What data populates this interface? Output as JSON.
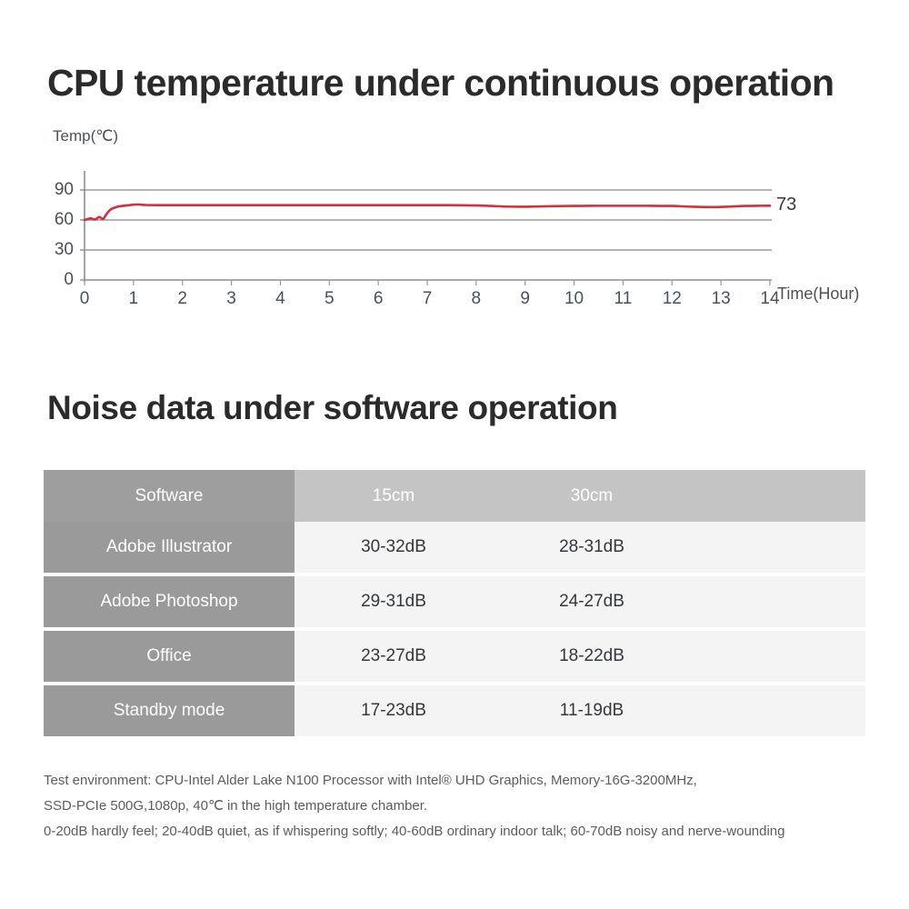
{
  "chart_section": {
    "title": "CPU temperature under continuous operation",
    "end_value_label": "73"
  },
  "chart_data": {
    "type": "line",
    "title": "CPU temperature under continuous operation",
    "xlabel": "Time(Hour)",
    "ylabel": "Temp(℃)",
    "xlim": [
      0,
      14
    ],
    "ylim": [
      0,
      100
    ],
    "grid": true,
    "legend": false,
    "xticks": [
      "0",
      "1",
      "2",
      "3",
      "4",
      "5",
      "6",
      "7",
      "8",
      "9",
      "10",
      "11",
      "12",
      "13",
      "14"
    ],
    "yticks": [
      "0",
      "30",
      "60",
      "90"
    ],
    "line_color": "#d32f3f",
    "series": [
      {
        "name": "CPU temperature",
        "x": [
          0,
          0.12,
          0.22,
          0.3,
          0.38,
          0.45,
          0.55,
          0.7,
          0.85,
          1.0,
          1.1,
          1.25,
          1.5,
          2.0,
          2.5,
          3.0,
          3.5,
          4.0,
          4.5,
          5.0,
          5.5,
          6.0,
          6.5,
          7.0,
          7.5,
          8.0,
          8.3,
          8.6,
          8.9,
          9.2,
          9.6,
          10.0,
          10.5,
          11.0,
          11.5,
          12.0,
          12.3,
          12.6,
          12.9,
          13.2,
          13.5,
          13.8,
          14.0
        ],
        "y": [
          60,
          61.5,
          60.5,
          63,
          61,
          66,
          71,
          73.5,
          74.5,
          75.3,
          75.5,
          75,
          74.8,
          74.8,
          74.8,
          74.8,
          74.8,
          74.8,
          74.8,
          74.8,
          74.8,
          74.8,
          74.8,
          74.8,
          74.8,
          74.5,
          74,
          73.4,
          73.2,
          73.4,
          73.8,
          74,
          74.2,
          74.2,
          74.2,
          74,
          73.4,
          73,
          72.9,
          73.4,
          74,
          74.2,
          74.3
        ]
      }
    ],
    "annotations": [
      {
        "text": "73",
        "at_x": 14,
        "at_y": 73
      }
    ]
  },
  "table_section": {
    "title": "Noise data under software operation",
    "columns": [
      "Software",
      "15cm",
      "30cm"
    ],
    "rows": [
      {
        "software": "Adobe Illustrator",
        "d15": "30-32dB",
        "d30": "28-31dB"
      },
      {
        "software": "Adobe Photoshop",
        "d15": "29-31dB",
        "d30": "24-27dB"
      },
      {
        "software": "Office",
        "d15": "23-27dB",
        "d30": "18-22dB"
      },
      {
        "software": "Standby mode",
        "d15": "17-23dB",
        "d30": "11-19dB"
      }
    ]
  },
  "notes": [
    "Test environment: CPU-Intel Alder Lake N100 Processor with Intel® UHD Graphics,  Memory-16G-3200MHz,",
    "SSD-PCIe 500G,1080p, 40℃ in the high temperature chamber.",
    "0-20dB hardly feel; 20-40dB quiet, as if whispering softly; 40-60dB ordinary indoor talk; 60-70dB noisy and nerve-wounding"
  ]
}
